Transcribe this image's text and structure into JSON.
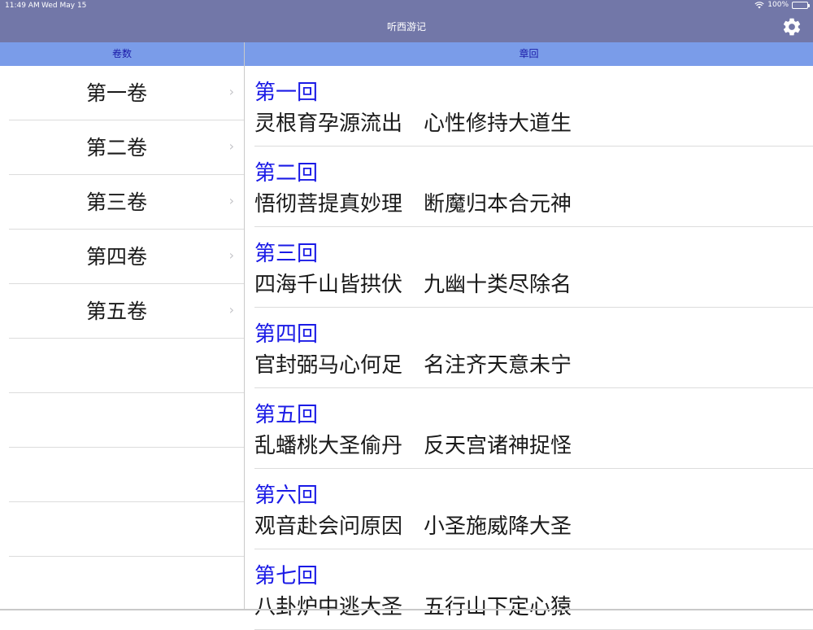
{
  "status": {
    "time": "11:49 AM",
    "date": "Wed May 15",
    "battery": "100%"
  },
  "nav": {
    "title": "听西游记"
  },
  "columns": {
    "left": "卷数",
    "right": "章回"
  },
  "volumes": [
    {
      "label": "第一卷"
    },
    {
      "label": "第二卷"
    },
    {
      "label": "第三卷"
    },
    {
      "label": "第四卷"
    },
    {
      "label": "第五卷"
    }
  ],
  "chapters": [
    {
      "num": "第一回",
      "title": "灵根育孕源流出　心性修持大道生"
    },
    {
      "num": "第二回",
      "title": "悟彻菩提真妙理　断魔归本合元神"
    },
    {
      "num": "第三回",
      "title": "四海千山皆拱伏　九幽十类尽除名"
    },
    {
      "num": "第四回",
      "title": "官封弼马心何足　名注齐天意未宁"
    },
    {
      "num": "第五回",
      "title": "乱蟠桃大圣偷丹　反天宫诸神捉怪"
    },
    {
      "num": "第六回",
      "title": "观音赴会问原因　小圣施威降大圣"
    },
    {
      "num": "第七回",
      "title": "八卦炉中逃大圣　五行山下定心猿"
    }
  ],
  "colors": {
    "navbar": "#7277a8",
    "column_header": "#7a9ce9",
    "chapter_number": "#1a1ae6"
  }
}
